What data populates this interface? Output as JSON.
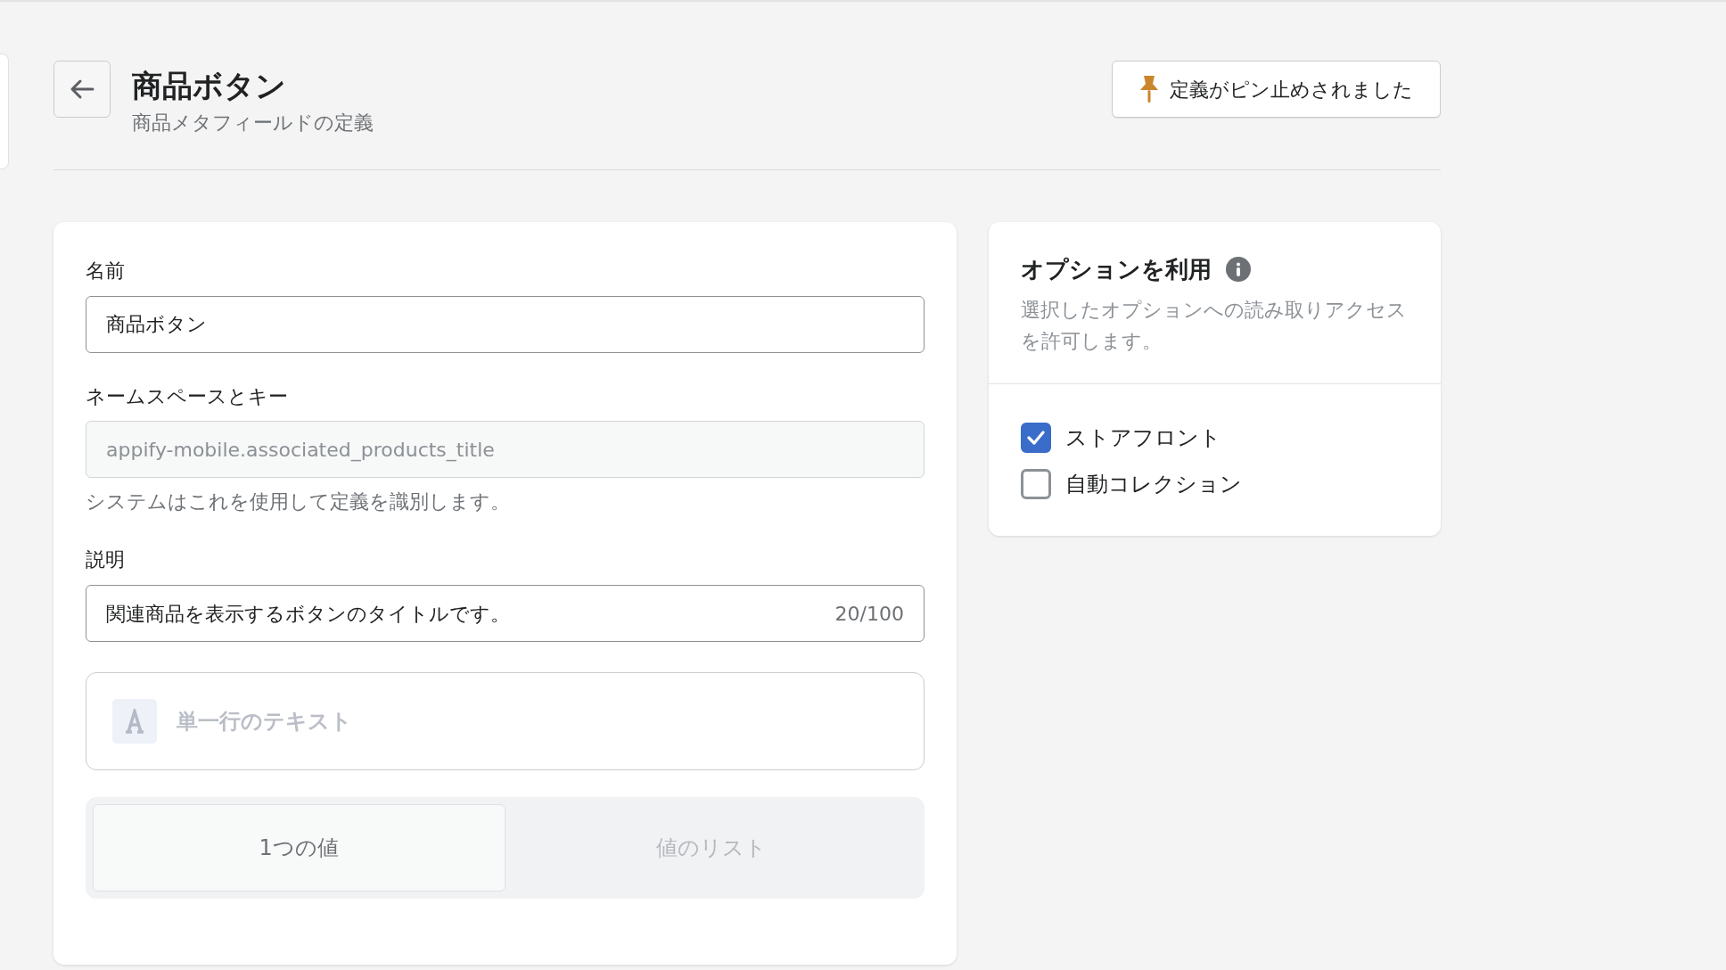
{
  "header": {
    "title": "商品ボタン",
    "subtitle": "商品メタフィールドの定義",
    "pin_button": {
      "label": "定義がピン止めされました"
    }
  },
  "form": {
    "name_field": {
      "label": "名前",
      "value": "商品ボタン"
    },
    "namespace_field": {
      "label": "ネームスペースとキー",
      "value": "appify-mobile.associated_products_title",
      "disabled": true,
      "help": "システムはこれを使用して定義を識別します。"
    },
    "description_field": {
      "label": "説明",
      "value": "関連商品を表示するボタンのタイトルです。",
      "counter": "20/100"
    },
    "type_selector": {
      "label": "単一行のテキスト",
      "disabled": true
    },
    "value_options": [
      {
        "label": "1つの値",
        "selected": true
      },
      {
        "label": "値のリスト",
        "selected": false
      }
    ]
  },
  "options_card": {
    "title": "オプションを利用",
    "description": "選択したオプションへの読み取りアクセスを許可します。",
    "checkboxes": [
      {
        "label": "ストアフロント",
        "checked": true
      },
      {
        "label": "自動コレクション",
        "checked": false
      }
    ]
  }
}
